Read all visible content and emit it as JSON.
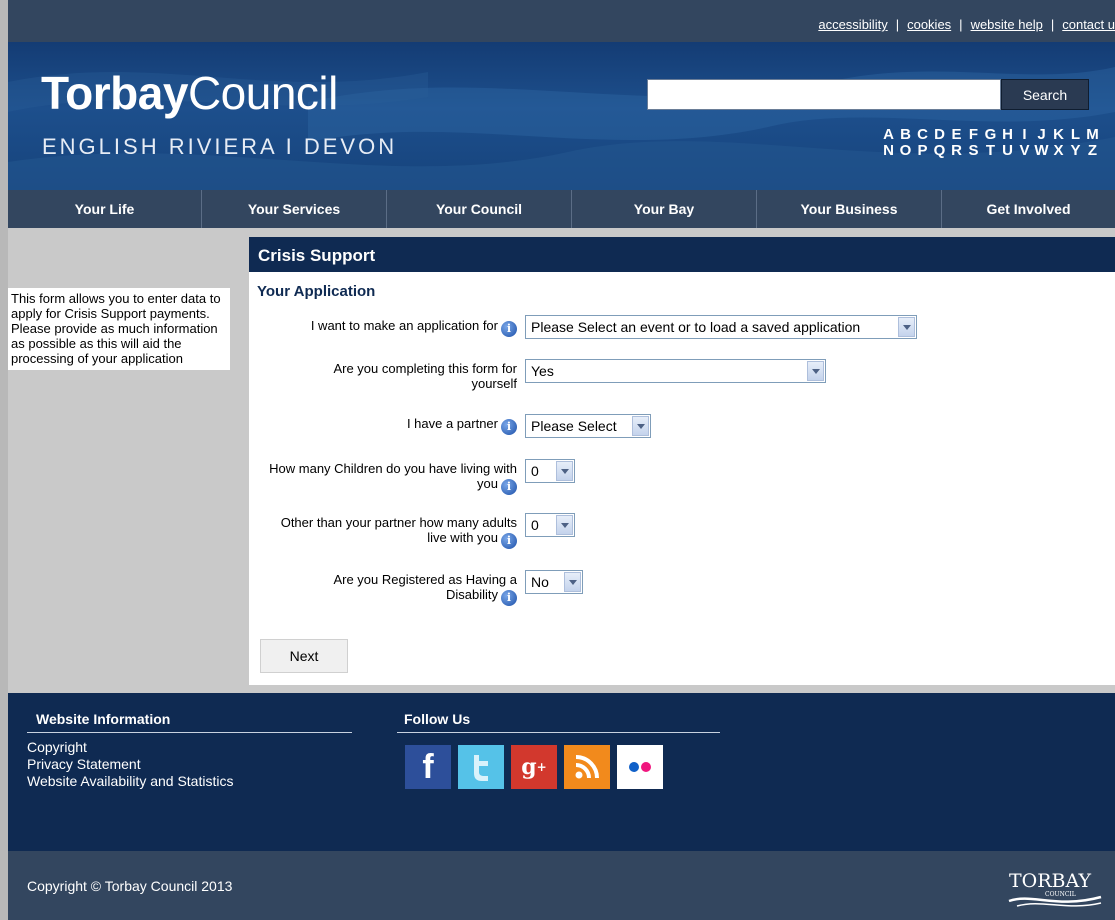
{
  "toplinks": [
    "accessibility",
    "cookies",
    "website help",
    "contact u"
  ],
  "logo": {
    "bold": "Torbay",
    "light": "Council",
    "sub": "ENGLISH RIVIERA I DEVON"
  },
  "search": {
    "value": "",
    "button": "Search"
  },
  "az_row1": [
    "A",
    "B",
    "C",
    "D",
    "E",
    "F",
    "G",
    "H",
    "I",
    "J",
    "K",
    "L",
    "M"
  ],
  "az_row2": [
    "N",
    "O",
    "P",
    "Q",
    "R",
    "S",
    "T",
    "U",
    "V",
    "W",
    "X",
    "Y",
    "Z"
  ],
  "nav": [
    "Your Life",
    "Your Services",
    "Your Council",
    "Your Bay",
    "Your Business",
    "Get Involved"
  ],
  "intro": "This form allows you to enter data to apply for Crisis Support payments. Please provide as much information as possible as this will aid the processing of your application",
  "panel": {
    "title": "Crisis Support",
    "subtitle": "Your Application"
  },
  "form": {
    "application_for": {
      "label": "I want to make an application for",
      "value": "Please Select an event or to load a saved application"
    },
    "for_yourself": {
      "label": "Are you completing this form for yourself",
      "value": "Yes"
    },
    "partner": {
      "label": "I have a partner",
      "value": "Please Select"
    },
    "children": {
      "label": "How many Children do you have living with you",
      "value": "0"
    },
    "adults": {
      "label": "Other than your partner how many adults live with you",
      "value": "0"
    },
    "disability": {
      "label": "Are you Registered as Having a Disability",
      "value": "No"
    },
    "next": "Next"
  },
  "footer": {
    "info_heading": "Website Information",
    "links": [
      "Copyright",
      "Privacy Statement",
      "Website Availability and Statistics"
    ],
    "follow_heading": "Follow Us",
    "copyright": "Copyright © Torbay Council 2013",
    "mini_logo": "TORBAY",
    "mini_logo_sub": "COUNCIL"
  },
  "colors": {
    "navy": "#0f2a52",
    "slate": "#33465f",
    "header_blue": "#1d4f8c"
  }
}
